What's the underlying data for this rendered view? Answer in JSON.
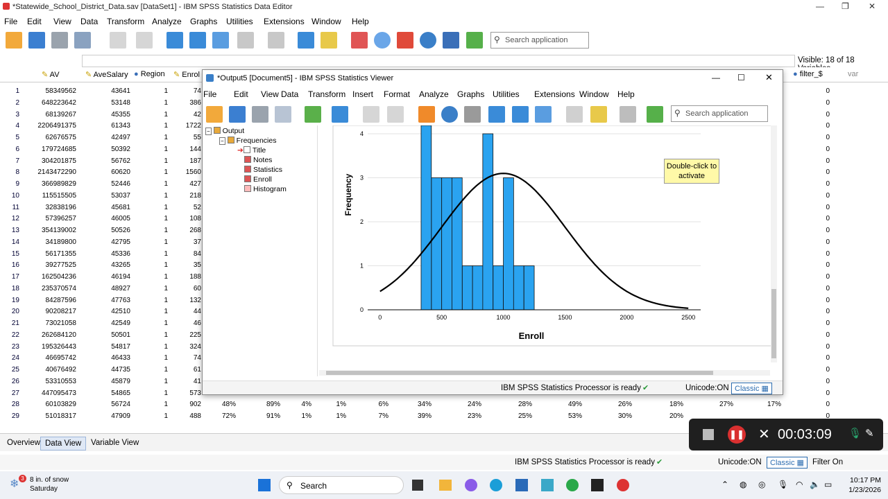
{
  "main_window": {
    "title": "*Statewide_School_District_Data.sav [DataSet1] - IBM SPSS Statistics Data Editor",
    "menu": [
      "File",
      "Edit",
      "View",
      "Data",
      "Transform",
      "Analyze",
      "Graphs",
      "Utilities",
      "Extensions",
      "Window",
      "Help"
    ],
    "search_placeholder": "Search application",
    "visible_label": "Visible: 18 of 18 Variables",
    "columns": [
      "AV",
      "AveSalary",
      "Region",
      "Enrol",
      "filter_$",
      "var"
    ],
    "rows": [
      [
        "1",
        "58349562",
        "43641",
        "1",
        "74"
      ],
      [
        "2",
        "648223642",
        "53148",
        "1",
        "386"
      ],
      [
        "3",
        "68139267",
        "45355",
        "1",
        "42"
      ],
      [
        "4",
        "2206491375",
        "61343",
        "1",
        "1722"
      ],
      [
        "5",
        "62676575",
        "42497",
        "1",
        "55"
      ],
      [
        "6",
        "179724685",
        "50392",
        "1",
        "144"
      ],
      [
        "7",
        "304201875",
        "56762",
        "1",
        "187"
      ],
      [
        "8",
        "2143472290",
        "60620",
        "1",
        "1560"
      ],
      [
        "9",
        "366989829",
        "52446",
        "1",
        "427"
      ],
      [
        "10",
        "115515505",
        "53037",
        "1",
        "218"
      ],
      [
        "11",
        "32838196",
        "45681",
        "1",
        "52"
      ],
      [
        "12",
        "57396257",
        "46005",
        "1",
        "108"
      ],
      [
        "13",
        "354139002",
        "50526",
        "1",
        "268"
      ],
      [
        "14",
        "34189800",
        "42795",
        "1",
        "37"
      ],
      [
        "15",
        "56171355",
        "45336",
        "1",
        "84"
      ],
      [
        "16",
        "39277525",
        "43265",
        "1",
        "35"
      ],
      [
        "17",
        "162504236",
        "46194",
        "1",
        "188"
      ],
      [
        "18",
        "235370574",
        "48927",
        "1",
        "60"
      ],
      [
        "19",
        "84287596",
        "47763",
        "1",
        "132"
      ],
      [
        "20",
        "90208217",
        "42510",
        "1",
        "44"
      ],
      [
        "21",
        "73021058",
        "42549",
        "1",
        "46"
      ],
      [
        "22",
        "262684120",
        "50501",
        "1",
        "225"
      ],
      [
        "23",
        "195326443",
        "54817",
        "1",
        "324"
      ],
      [
        "24",
        "46695742",
        "46433",
        "1",
        "74"
      ],
      [
        "25",
        "40676492",
        "44735",
        "1",
        "61"
      ],
      [
        "26",
        "53310553",
        "45879",
        "1",
        "41"
      ],
      [
        "27",
        "447095473",
        "54865",
        "1",
        "573"
      ],
      [
        "28",
        "60103829",
        "56724",
        "1",
        "902"
      ],
      [
        "29",
        "51018317",
        "47909",
        "1",
        "488"
      ]
    ],
    "filter_values": "0",
    "row28_extra": [
      "48%",
      "89%",
      "4%",
      "1%",
      "6%",
      "34%",
      "24%",
      "28%",
      "49%",
      "26%",
      "18%",
      "27%",
      "17%"
    ],
    "row29_extra": [
      "72%",
      "91%",
      "1%",
      "1%",
      "7%",
      "39%",
      "23%",
      "25%",
      "53%",
      "30%",
      "20%"
    ],
    "tabs": [
      "Overview",
      "Data View",
      "Variable View"
    ],
    "status": "IBM SPSS Statistics Processor is ready",
    "unicode": "Unicode:ON",
    "classic": "Classic",
    "filter": "Filter On"
  },
  "viewer": {
    "title": "*Output5 [Document5] - IBM SPSS Statistics Viewer",
    "menu": [
      "File",
      "Edit",
      "View",
      "Data",
      "Transform",
      "Insert",
      "Format",
      "Analyze",
      "Graphs",
      "Utilities",
      "Extensions",
      "Window",
      "Help"
    ],
    "search_placeholder": "Search application",
    "outline": [
      "Output",
      "Frequencies",
      "Title",
      "Notes",
      "Statistics",
      "Enroll",
      "Histogram"
    ],
    "tooltip": "Double-click to activate",
    "status": "IBM SPSS Statistics Processor is ready",
    "unicode": "Unicode:ON",
    "classic": "Classic"
  },
  "chart_data": {
    "type": "bar",
    "xlabel": "Enroll",
    "ylabel": "Frequency",
    "xlim": [
      -100,
      2600
    ],
    "ylim": [
      0,
      4
    ],
    "x_ticks": [
      0,
      500,
      1000,
      1500,
      2000,
      2500
    ],
    "y_ticks": [
      0,
      1,
      2,
      3,
      4
    ],
    "bin_width": 83.3,
    "bins": [
      {
        "x0": 333,
        "count": 4.5
      },
      {
        "x0": 417,
        "count": 3
      },
      {
        "x0": 500,
        "count": 3
      },
      {
        "x0": 583,
        "count": 3
      },
      {
        "x0": 667,
        "count": 1
      },
      {
        "x0": 750,
        "count": 1
      },
      {
        "x0": 833,
        "count": 4
      },
      {
        "x0": 917,
        "count": 1
      },
      {
        "x0": 1000,
        "count": 3
      },
      {
        "x0": 1083,
        "count": 1
      },
      {
        "x0": 1167,
        "count": 1
      }
    ],
    "normal_curve": {
      "mean": 1000,
      "sd": 500,
      "peak": 3.1
    }
  },
  "recorder": {
    "time": "00:03:09"
  },
  "taskbar": {
    "weather_temp": "8 in. of snow",
    "weather_day": "Saturday",
    "weather_badge": "3",
    "search": "Search",
    "time": "10:17 PM",
    "date": "1/23/2026"
  },
  "colors": {
    "bar": "#2aa3f0",
    "tooltip": "#fff9a8",
    "accent": "#2b6cb0"
  }
}
